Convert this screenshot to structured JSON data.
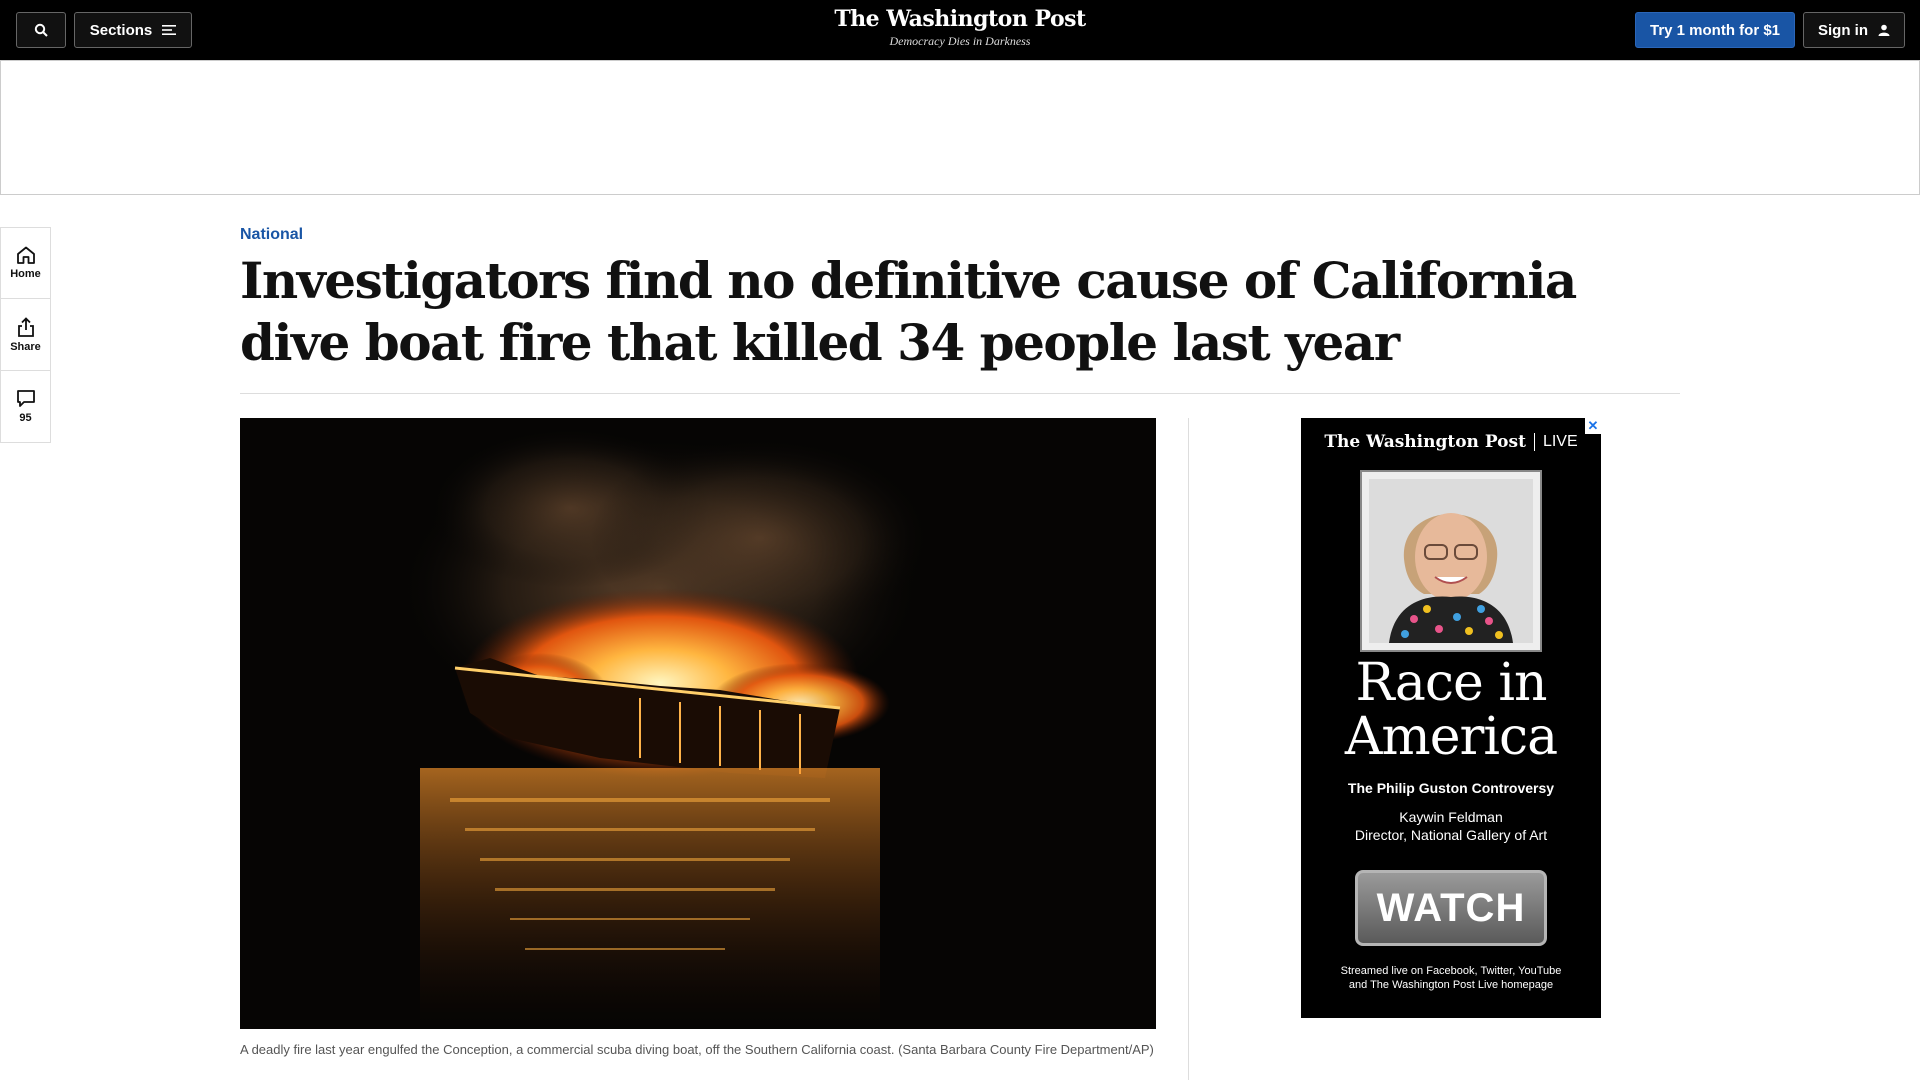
{
  "topbar": {
    "search_icon": "search-icon",
    "sections_label": "Sections",
    "logo": "The Washington Post",
    "tagline": "Democracy Dies in Darkness",
    "try_label": "Try 1 month for $1",
    "signin_label": "Sign in"
  },
  "left_rail": {
    "home_label": "Home",
    "share_label": "Share",
    "comments_count": "95"
  },
  "article": {
    "kicker": "National",
    "headline": "Investigators find no definitive cause of California dive boat fire that killed 34 people last year",
    "caption": "A deadly fire last year engulfed the Conception, a commercial scuba diving boat, off the Southern California coast. (Santa Barbara County Fire Department/AP)"
  },
  "side_ad": {
    "close": "✕",
    "brand": "The Washington Post",
    "live": "LIVE",
    "title_line1": "Race in",
    "title_line2": "America",
    "subtitle": "The Philip Guston Controversy",
    "person_name": "Kaywin Feldman",
    "person_role": "Director, National Gallery of Art",
    "cta": "WATCH",
    "footer_line1": "Streamed live on Facebook, Twitter, YouTube",
    "footer_line2": "and The Washington Post Live homepage"
  },
  "colors": {
    "accent": "#1955a5",
    "topbar": "#000000"
  }
}
